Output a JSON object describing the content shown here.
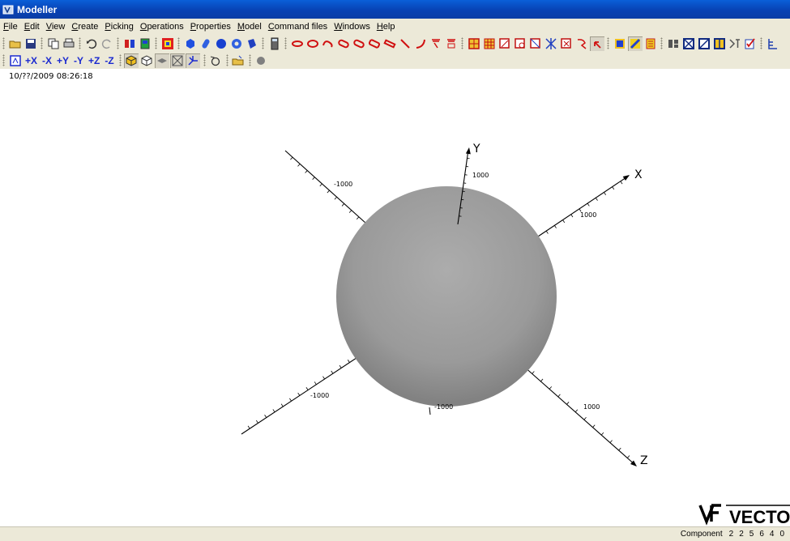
{
  "window": {
    "title": "Modeller"
  },
  "menu": [
    "File",
    "Edit",
    "View",
    "Create",
    "Picking",
    "Operations",
    "Properties",
    "Model",
    "Command files",
    "Windows",
    "Help"
  ],
  "menu_underline": [
    0,
    0,
    0,
    0,
    0,
    0,
    0,
    0,
    0,
    0,
    0
  ],
  "toolbar2": {
    "view_buttons": [
      "+X",
      "-X",
      "+Y",
      "-Y",
      "+Z",
      "-Z"
    ]
  },
  "viewport": {
    "timestamp": "10/??/2009 08:26:18",
    "axes": {
      "x_label": "X",
      "y_label": "Y",
      "z_label": "Z",
      "x_pos_tick": "1000",
      "x_neg_tick": "-1000",
      "y_pos_tick": "1000",
      "y_neg_tick": "-1000",
      "z_pos_tick": "1000",
      "z_neg_tick": "-1000"
    },
    "sphere_color": "#a8a8a8"
  },
  "logo": {
    "text": "VECTO"
  },
  "status": {
    "label": "Component",
    "values": [
      "2",
      "2",
      "5",
      "6",
      "4",
      "0"
    ]
  },
  "colors": {
    "titlebar": "#0a4fc8",
    "chrome": "#ece9d8",
    "view_button": "#1b2ad0",
    "red_tool": "#d01010"
  }
}
